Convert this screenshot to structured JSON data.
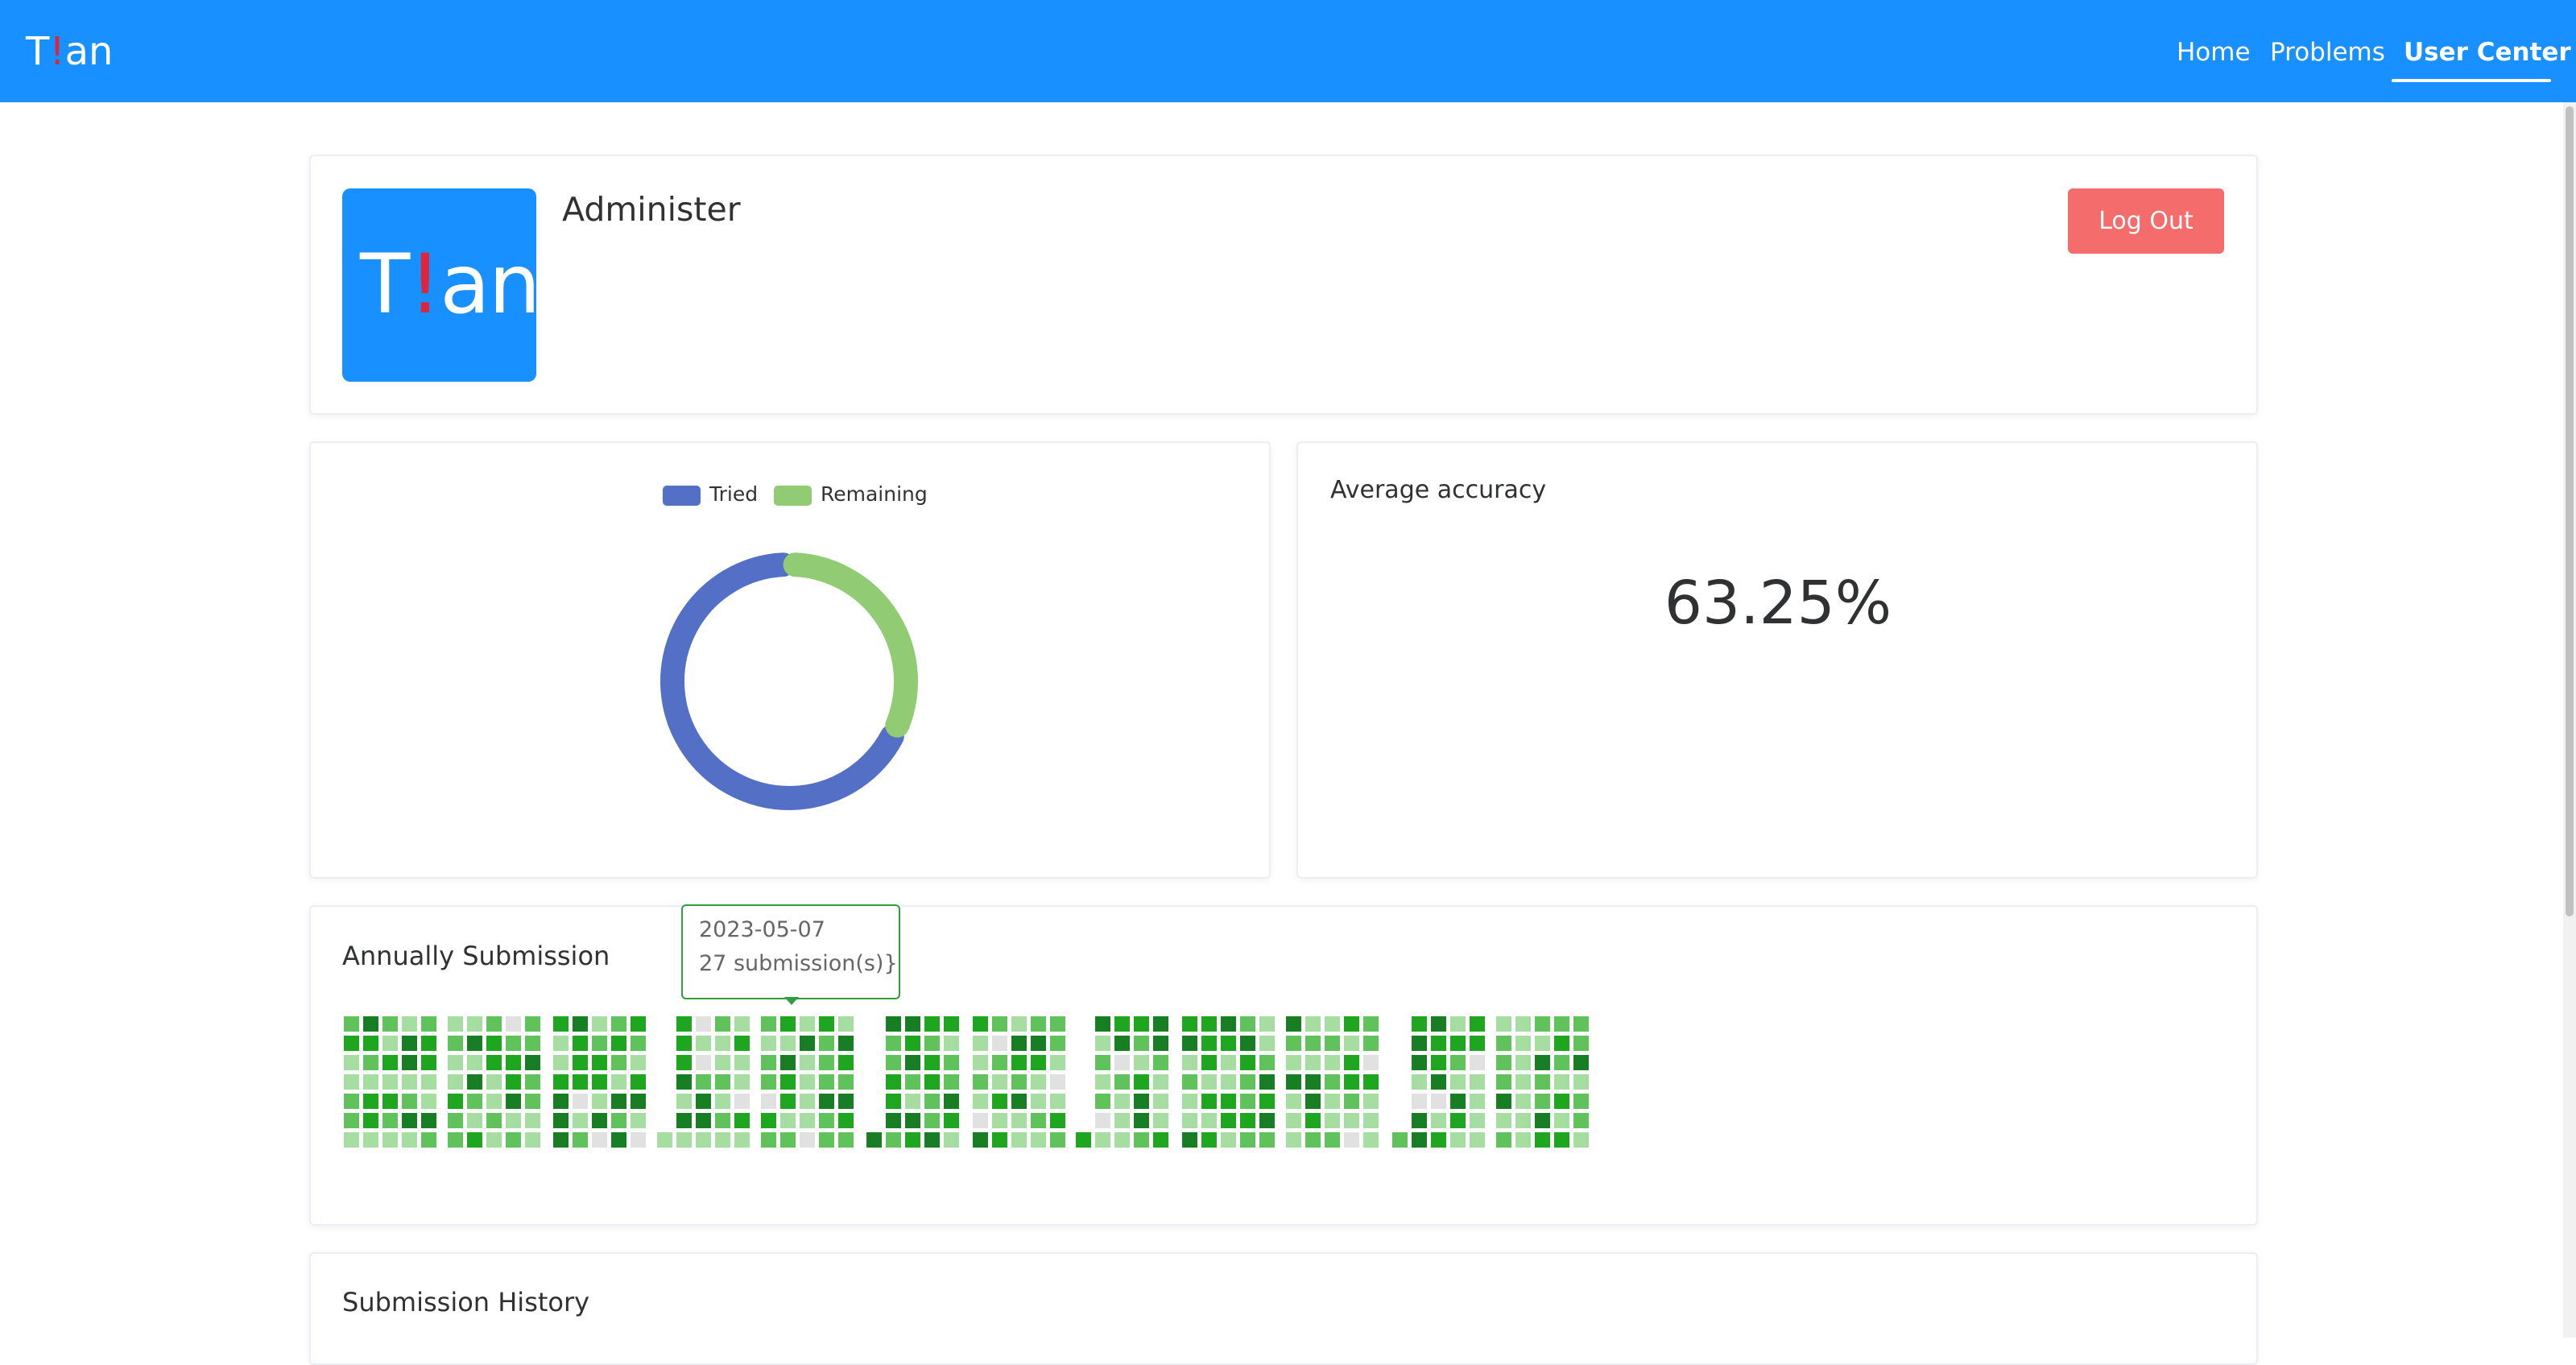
{
  "header": {
    "logo_prefix": "T",
    "logo_bang": "!",
    "logo_suffix": "an",
    "nav": [
      {
        "label": "Home"
      },
      {
        "label": "Problems"
      },
      {
        "label": "User Center",
        "active": true
      }
    ],
    "bg_color": "#1890ff"
  },
  "profile": {
    "avatar_prefix": "T",
    "avatar_bang": "!",
    "avatar_suffix": "an",
    "username": "Administer",
    "logout_label": "Log Out"
  },
  "problems_chart": {
    "legend": [
      {
        "label": "Tried",
        "color": "#5470c6"
      },
      {
        "label": "Remaining",
        "color": "#91cc75"
      }
    ]
  },
  "accuracy": {
    "title": "Average accuracy",
    "value": "63.25%"
  },
  "annual": {
    "title": "Annually Submission",
    "tooltip": {
      "date": "2023-05-07",
      "count": "27 submission(s)}"
    },
    "colors": {
      "empty": "#e1e1e1",
      "level1": "#a5dea0",
      "level2": "#5fc25a",
      "level3": "#1ea71e",
      "level4": "#187e24"
    }
  },
  "history": {
    "title": "Submission History"
  },
  "chart_data": {
    "type": "pie",
    "categories": [
      "Tried",
      "Remaining"
    ],
    "values": [
      68,
      32
    ]
  }
}
